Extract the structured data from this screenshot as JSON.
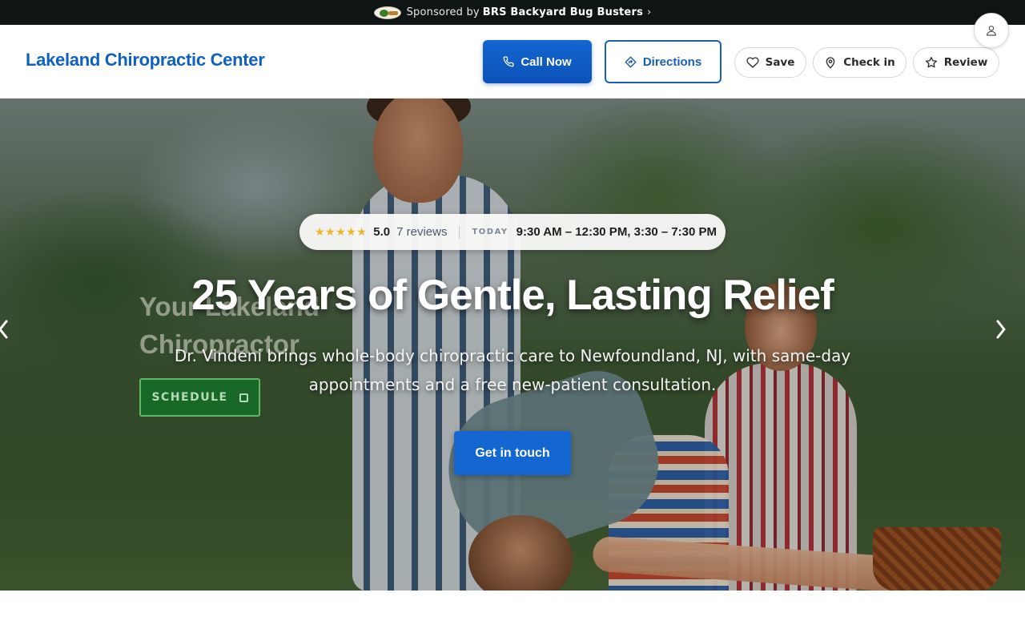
{
  "sponsor": {
    "prefix": "Sponsored by",
    "name": "BRS Backyard Bug Busters",
    "chevron": "›",
    "logo_icon": "bug-busters-logo"
  },
  "header": {
    "brand": "Lakeland Chiropractic Center",
    "brand_color": "#1060c0",
    "call_label": "Call Now",
    "directions_label": "Directions",
    "save_label": "Save",
    "checkin_label": "Check in",
    "review_label": "Review",
    "accent_color": "#1466d0"
  },
  "hero": {
    "stars": "★★★★★",
    "rating": "5.0",
    "reviews": "7 reviews",
    "today_label": "TODAY",
    "hours": "9:30 AM – 12:30 PM, 3:30 – 7:30 PM",
    "title": "25 Years of Gentle, Lasting Relief",
    "subtitle": "Dr. Vindeni brings whole-body chiropractic care to Newfoundland, NJ, with same-day appointments and a free new-patient consultation.",
    "cta": "Get in touch",
    "ghost_title": "Your Lakeland Chiropractor",
    "ghost_button": "SCHEDULE",
    "star_color": "#f0b429"
  }
}
